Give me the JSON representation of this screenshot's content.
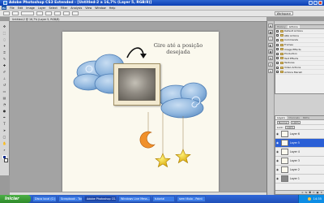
{
  "window": {
    "title": "Adobe Photoshop CS3 Extended - [Untitled-2 a 16,7% (Layer 5, RGB/8)]"
  },
  "menu": {
    "items": [
      "File",
      "Edit",
      "Image",
      "Layer",
      "Select",
      "Filter",
      "Analysis",
      "View",
      "Window",
      "Help"
    ]
  },
  "options": {
    "workspace": "Workspace"
  },
  "document": {
    "tab_title": "Untitled-2 @ 16,7% (Layer 5, RGB/8)",
    "scrap_text": "Gire até a posição desejada"
  },
  "panels": {
    "actions_tabs": [
      "History",
      "Actions"
    ],
    "actions": [
      "Default Actions",
      "ARA Actions",
      "Commands",
      "Frames",
      "Image Effects",
      "Production",
      "Text Effects",
      "Textures",
      "Video Actions",
      "Actions Mariah"
    ],
    "layers_tabs": [
      "Layers",
      "Channels",
      "Paths"
    ],
    "blend_mode": "Normal",
    "opacity": "100%",
    "lock_label": "Lock:",
    "fill": "100%",
    "layers": [
      "Layer 6",
      "Layer 5",
      "Layer 4",
      "Layer 3",
      "Layer 2",
      "Layer 1"
    ]
  },
  "taskbar": {
    "start": "Iniciar",
    "tasks": [
      "Disco local (C:)",
      "Scrapbook - Todos...",
      "Adobe Photoshop CS...",
      "Windows Live Mess...",
      "tutorial",
      "sem título - Paint"
    ],
    "clock": "14:35"
  },
  "colors": {
    "title_bar": "#0b3fb5",
    "taskbar": "#1f4fb8",
    "start_button": "#2e8a2a",
    "active_layer": "#2a5fd6",
    "canvas_paper": "#fbf9ee",
    "cloud_blue": "#8fb6de"
  },
  "icons": {
    "arrow": "curved-rotate-arrow",
    "moon": "crescent-moon",
    "stars": "hanging-star"
  }
}
